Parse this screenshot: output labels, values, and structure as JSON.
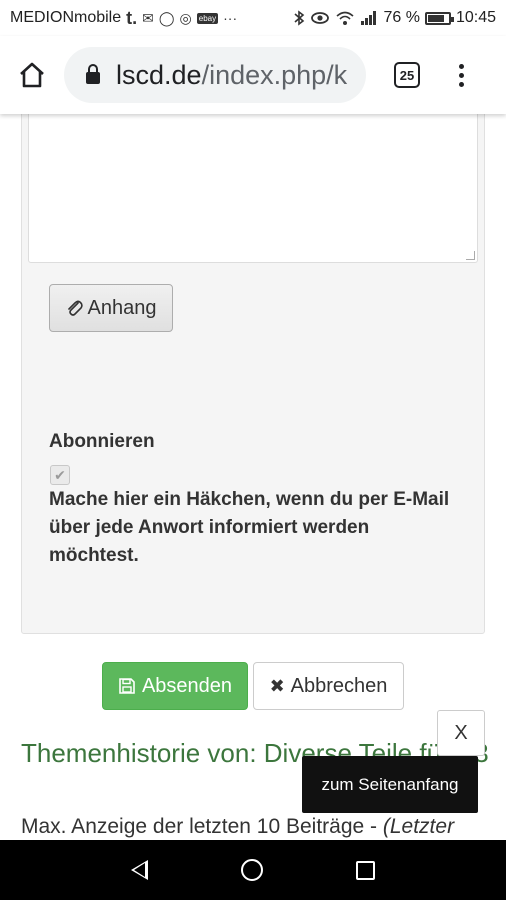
{
  "status_bar": {
    "carrier": "MEDIONmobile",
    "left_icons": [
      "t.",
      "✉",
      "◯",
      "◎",
      "ebay",
      "···"
    ],
    "right_icons": [
      "bluetooth-icon",
      "eye-icon",
      "wifi-icon",
      "signal-icon"
    ],
    "battery": "76 %",
    "time": "10:45"
  },
  "browser": {
    "url_host": "lscd.de",
    "url_path": "/index.php/k",
    "tab_count": "25"
  },
  "form": {
    "attach_label": "Anhang",
    "subscribe_heading": "Abonnieren",
    "subscribe_text": "Mache hier ein Häkchen, wenn du per E-Mail über jede Anwort informiert werden möchtest.",
    "subscribe_checked": true
  },
  "actions": {
    "send_label": "Absenden",
    "cancel_label": "Abbrechen"
  },
  "history": {
    "title": "Themenhistorie von: Diverse Teile für S3",
    "subtitle_main": "Max. Anzeige der letzten 10 Beiträge - ",
    "subtitle_italic": "(Letzter"
  },
  "overlay": {
    "close_label": "X",
    "to_top_label": "zum Seitenanfang"
  },
  "colors": {
    "send_button": "#5cb85c",
    "history_title": "#3c763d",
    "panel_bg": "#f5f5f5"
  }
}
